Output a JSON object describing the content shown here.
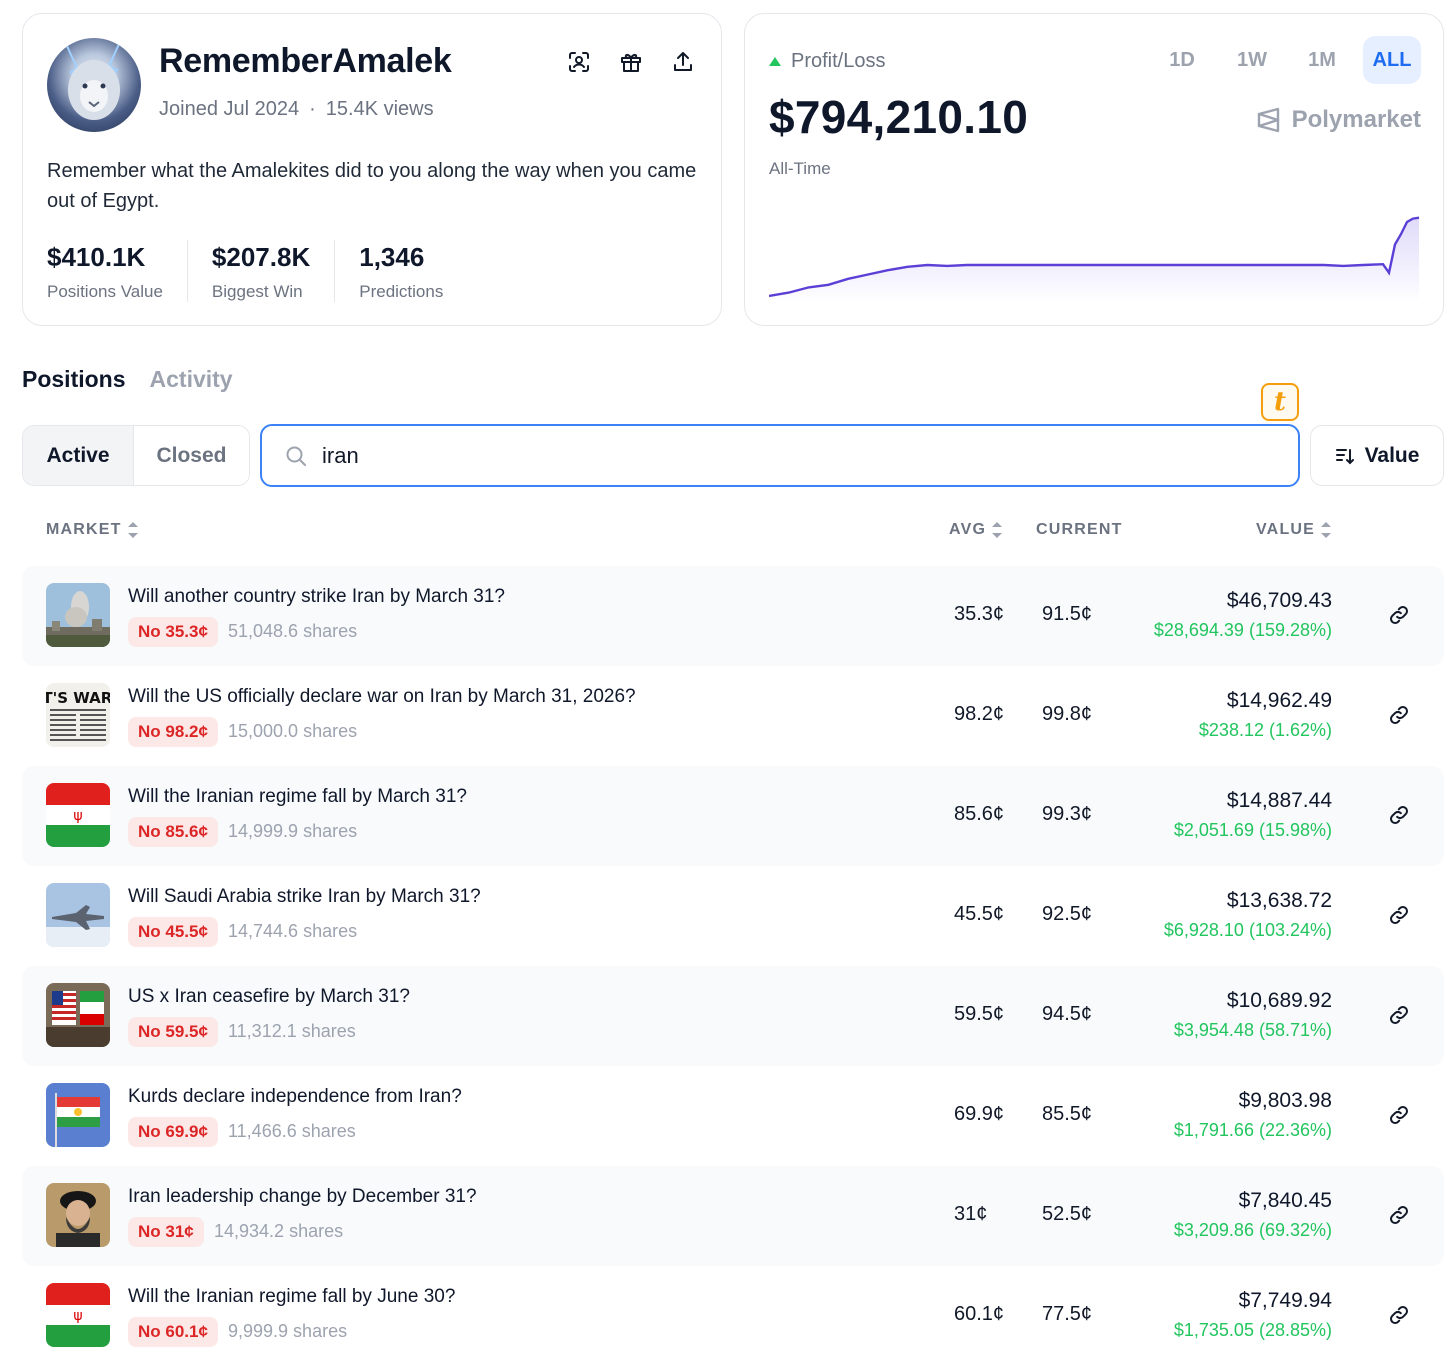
{
  "profile": {
    "username": "RememberAmalek",
    "joined": "Joined Jul 2024",
    "views": "15.4K views",
    "bio": "Remember what the Amalekites did to you along the way when you came out of Egypt.",
    "icons": [
      "scan-face-icon",
      "gift-icon",
      "share-upload-icon"
    ],
    "stats": [
      {
        "value": "$410.1K",
        "label": "Positions Value"
      },
      {
        "value": "$207.8K",
        "label": "Biggest Win"
      },
      {
        "value": "1,346",
        "label": "Predictions"
      }
    ]
  },
  "pnl": {
    "label": "Profit/Loss",
    "value": "$794,210.10",
    "period": "All-Time",
    "brand": "Polymarket",
    "ranges": [
      "1D",
      "1W",
      "1M",
      "ALL"
    ],
    "active_range": "ALL",
    "colors": {
      "line": "#5b3fd6",
      "up": "#22c55e"
    }
  },
  "chart_data": {
    "type": "line",
    "title": "",
    "series": [
      {
        "values": [
          0,
          0.04,
          0.1,
          0.13,
          0.2,
          0.25,
          0.3,
          0.34,
          0.36,
          0.35,
          0.36,
          0.36,
          0.36,
          0.36,
          0.36,
          0.36,
          0.36,
          0.36,
          0.36,
          0.36,
          0.36,
          0.36,
          0.36,
          0.36,
          0.36,
          0.36,
          0.36,
          0.36,
          0.36,
          0.35,
          0.36,
          0.37,
          0.27,
          0.6,
          0.72,
          0.86,
          0.9,
          0.91
        ]
      }
    ]
  },
  "tabs": [
    "Positions",
    "Activity"
  ],
  "active_tab": "Positions",
  "filter": {
    "active": "Active",
    "closed": "Closed"
  },
  "search": {
    "value": "iran",
    "placeholder": "Search"
  },
  "sort": {
    "label": "Value"
  },
  "columns": {
    "market": "MARKET",
    "avg": "AVG",
    "current": "CURRENT",
    "value": "VALUE"
  },
  "positions": [
    {
      "title": "Will another country strike Iran by March 31?",
      "side": "No 35.3¢",
      "shares": "51,048.6 shares",
      "avg": "35.3¢",
      "current": "91.5¢",
      "value": "$46,709.43",
      "gain": "$28,694.39 (159.28%)",
      "thumb": "smoke-city-image"
    },
    {
      "title": "Will the US officially declare war on Iran by March 31, 2026?",
      "side": "No 98.2¢",
      "shares": "15,000.0 shares",
      "avg": "98.2¢",
      "current": "99.8¢",
      "value": "$14,962.49",
      "gain": "$238.12 (1.62%)",
      "thumb": "newspaper-its-war-image",
      "thumb_text": "IT'S WAR!"
    },
    {
      "title": "Will the Iranian regime fall by March 31?",
      "side": "No 85.6¢",
      "shares": "14,999.9 shares",
      "avg": "85.6¢",
      "current": "99.3¢",
      "value": "$14,887.44",
      "gain": "$2,051.69 (15.98%)",
      "thumb": "iran-flag-image"
    },
    {
      "title": "Will Saudi Arabia strike Iran by March 31?",
      "side": "No 45.5¢",
      "shares": "14,744.6 shares",
      "avg": "45.5¢",
      "current": "92.5¢",
      "value": "$13,638.72",
      "gain": "$6,928.10 (103.24%)",
      "thumb": "fighter-jet-image"
    },
    {
      "title": "US x Iran ceasefire by March 31?",
      "side": "No 59.5¢",
      "shares": "11,312.1 shares",
      "avg": "59.5¢",
      "current": "94.5¢",
      "value": "$10,689.92",
      "gain": "$3,954.48 (58.71%)",
      "thumb": "us-iran-flags-image"
    },
    {
      "title": "Kurds declare independence from Iran?",
      "side": "No 69.9¢",
      "shares": "11,466.6 shares",
      "avg": "69.9¢",
      "current": "85.5¢",
      "value": "$9,803.98",
      "gain": "$1,791.66 (22.36%)",
      "thumb": "kurdistan-flag-image"
    },
    {
      "title": "Iran leadership change by December 31?",
      "side": "No 31¢",
      "shares": "14,934.2 shares",
      "avg": "31¢",
      "current": "52.5¢",
      "value": "$7,840.45",
      "gain": "$3,209.86 (69.32%)",
      "thumb": "cleric-portrait-image"
    },
    {
      "title": "Will the Iranian regime fall by June 30?",
      "side": "No 60.1¢",
      "shares": "9,999.9 shares",
      "avg": "60.1¢",
      "current": "77.5¢",
      "value": "$7,749.94",
      "gain": "$1,735.05 (28.85%)",
      "thumb": "iran-flag-image"
    }
  ]
}
